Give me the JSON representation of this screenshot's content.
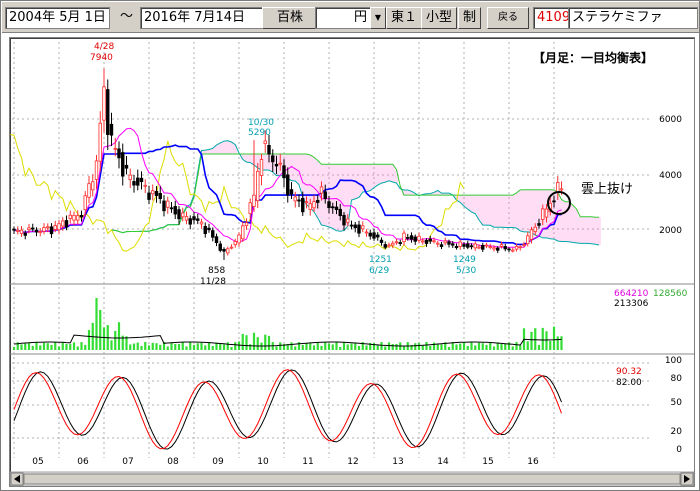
{
  "toolbar": {
    "date_start": "2004年  5月  1日",
    "tilde": "～",
    "date_end": "2016年  7月14日",
    "unit_label": "百株",
    "currency_value": "円",
    "market": "東１",
    "size": "小型",
    "margin": "制",
    "back_button": "戻る",
    "code": "4109",
    "name": "ステラケミファ"
  },
  "chart": {
    "title": "【月足：一目均衡表】",
    "annotation": "雲上抜け",
    "price_axis": [
      "6000",
      "4000",
      "2000"
    ],
    "osc_axis": [
      "100",
      "80",
      "50",
      "20",
      "0"
    ],
    "x_axis": [
      "05",
      "06",
      "07",
      "08",
      "09",
      "10",
      "11",
      "12",
      "13",
      "14",
      "15",
      "16"
    ],
    "labels": {
      "high_2006_date": "4/28",
      "high_2006_value": "7940",
      "low_2008_value": "858",
      "low_2008_date": "11/28",
      "high_2009_date": "10/30",
      "high_2009_value": "5290",
      "low_2012_value": "1251",
      "low_2012_date": "6/29",
      "low_2014_value": "1249",
      "low_2014_date": "5/30"
    },
    "volume": {
      "current": "664210",
      "average": "213306",
      "max": "128560"
    },
    "oscillator": {
      "k": "90.32",
      "d": "82.00"
    }
  },
  "colors": {
    "toolbar_bg": "#d4d0c8",
    "up_candle": "#ff3030",
    "down_candle": "#000000",
    "tenkan": "#ff00ff",
    "kijun": "#0000ff",
    "senkou_a": "#00aaaa",
    "senkou_b": "#33cc33",
    "chikou": "#dddd00",
    "cloud": "#ff66cc",
    "volume": "#33dd33"
  }
}
